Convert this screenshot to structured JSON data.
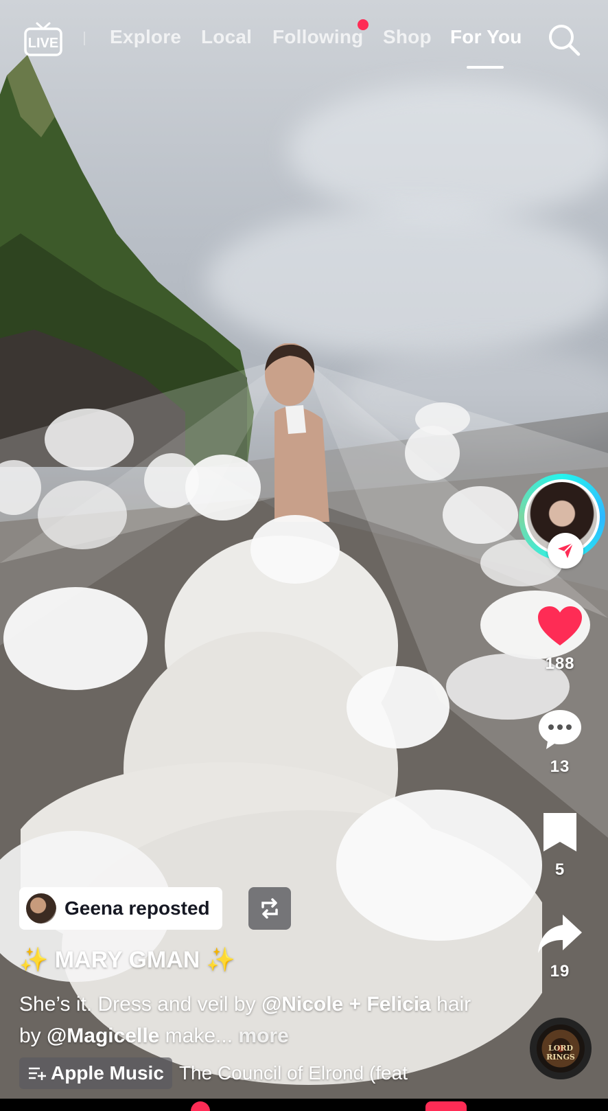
{
  "topnav": {
    "live_label": "LIVE",
    "tabs": [
      {
        "label": "Explore"
      },
      {
        "label": "Local"
      },
      {
        "label": "Following"
      },
      {
        "label": "Shop"
      },
      {
        "label": "For You"
      }
    ],
    "active_tab": "For You"
  },
  "rail": {
    "likes": "188",
    "comments": "13",
    "saves": "5",
    "shares": "19"
  },
  "post": {
    "repost_text": "Geena reposted",
    "author": "✨ MARY GMAN ✨",
    "caption_part1": "She’s it. Dress and veil by ",
    "mention1": "@Nicole + Felicia",
    "caption_part2": " hair by ",
    "mention2": "@Magicelle",
    "caption_part3": " make...",
    "more_label": "more"
  },
  "music": {
    "chip_label": "Apple Music",
    "title": "The Council of Elrond (feat",
    "disc_text": "LORD RINGS"
  },
  "colors": {
    "accent": "#fe2c55",
    "like": "#fe2c55",
    "ring": "#25f4ee"
  }
}
